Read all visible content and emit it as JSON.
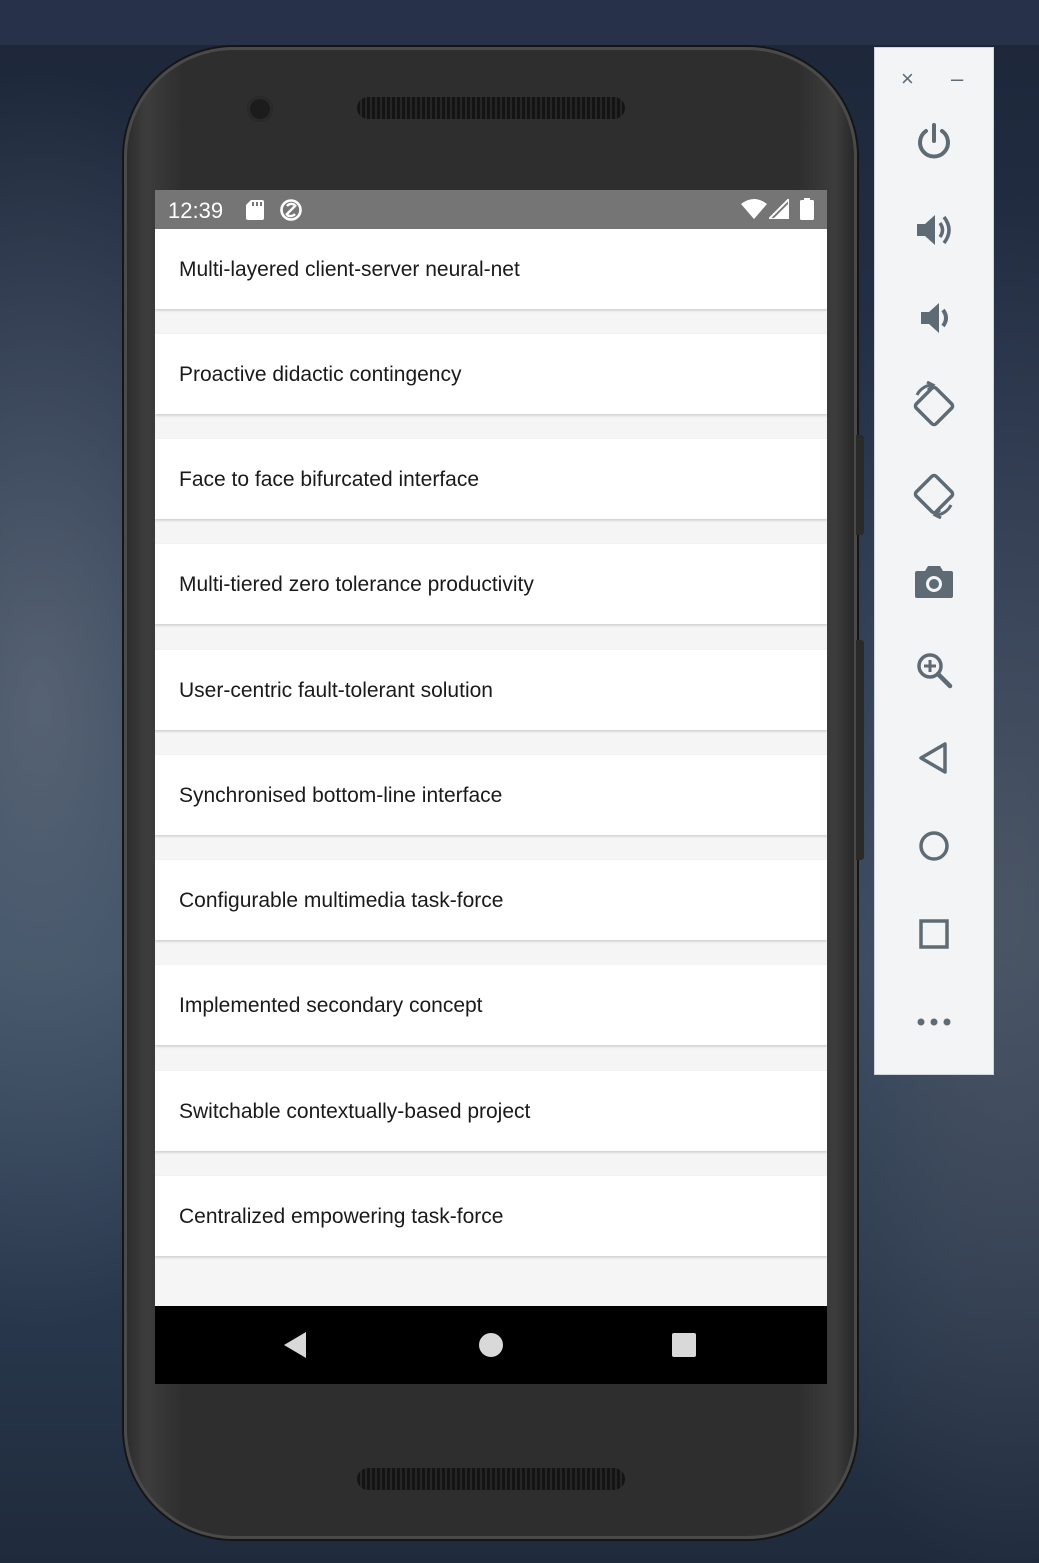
{
  "status_bar": {
    "time": "12:39",
    "left_icons": [
      "sd-card-icon",
      "sync-icon"
    ],
    "right_icons": [
      "wifi-icon",
      "cell-signal-icon",
      "battery-icon"
    ]
  },
  "list": {
    "items": [
      {
        "label": "Multi-layered client-server neural-net"
      },
      {
        "label": "Proactive didactic contingency"
      },
      {
        "label": "Face to face bifurcated interface"
      },
      {
        "label": "Multi-tiered zero tolerance productivity"
      },
      {
        "label": "User-centric fault-tolerant solution"
      },
      {
        "label": "Synchronised bottom-line interface"
      },
      {
        "label": "Configurable multimedia task-force"
      },
      {
        "label": "Implemented secondary concept"
      },
      {
        "label": "Switchable contextually-based project"
      },
      {
        "label": "Centralized empowering task-force"
      }
    ]
  },
  "nav_bar": {
    "buttons": [
      "back-icon",
      "home-icon",
      "recents-icon"
    ]
  },
  "emulator_toolbar": {
    "window_controls": {
      "close": "×",
      "minimize": "–"
    },
    "buttons": [
      "power-icon",
      "volume-up-icon",
      "volume-down-icon",
      "rotate-left-icon",
      "rotate-right-icon",
      "camera-icon",
      "zoom-icon",
      "back-icon",
      "home-icon",
      "overview-icon",
      "more-icon"
    ]
  },
  "colors": {
    "status_bar": "#757575",
    "toolbar_icon": "#5f6b74",
    "list_background": "#f5f5f5",
    "card_background": "#ffffff"
  }
}
